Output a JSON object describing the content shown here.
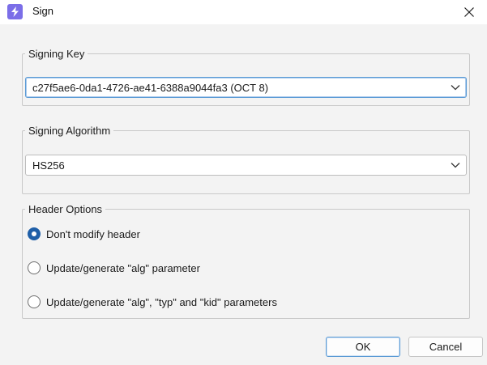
{
  "window": {
    "title": "Sign",
    "app_icon": "lightning-bolt-icon",
    "accent_color": "#7b6ee8"
  },
  "signing_key": {
    "legend": "Signing Key",
    "selected": "c27f5ae6-0da1-4726-ae41-6388a9044fa3 (OCT 8)"
  },
  "signing_algorithm": {
    "legend": "Signing Algorithm",
    "selected": "HS256"
  },
  "header_options": {
    "legend": "Header Options",
    "options": [
      {
        "label": "Don't modify header",
        "checked": true
      },
      {
        "label": "Update/generate \"alg\" parameter",
        "checked": false
      },
      {
        "label": "Update/generate \"alg\", \"typ\" and \"kid\" parameters",
        "checked": false
      }
    ]
  },
  "buttons": {
    "ok": "OK",
    "cancel": "Cancel"
  }
}
